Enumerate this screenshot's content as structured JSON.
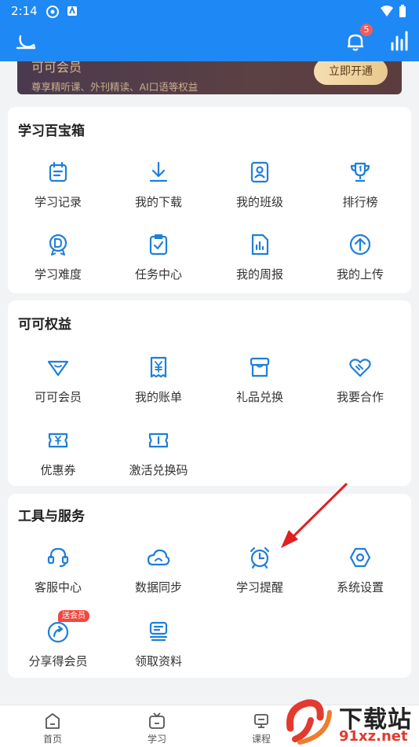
{
  "status": {
    "time": "2:14"
  },
  "header": {
    "badge_count": "5"
  },
  "banner": {
    "title": "可可会员",
    "subtitle": "尊享精听课、外刊精读、AI口语等权益",
    "button": "立即开通"
  },
  "toolbox": {
    "title": "学习百宝箱",
    "items": [
      {
        "label": "学习记录",
        "icon": "calendar-icon"
      },
      {
        "label": "我的下载",
        "icon": "download-icon"
      },
      {
        "label": "我的班级",
        "icon": "class-icon"
      },
      {
        "label": "排行榜",
        "icon": "trophy-icon"
      },
      {
        "label": "学习难度",
        "icon": "difficulty-badge-icon"
      },
      {
        "label": "任务中心",
        "icon": "clipboard-check-icon"
      },
      {
        "label": "我的周报",
        "icon": "report-chart-icon"
      },
      {
        "label": "我的上传",
        "icon": "upload-icon"
      }
    ]
  },
  "benefits": {
    "title": "可可权益",
    "items": [
      {
        "label": "可可会员",
        "icon": "diamond-icon"
      },
      {
        "label": "我的账单",
        "icon": "bill-yen-icon"
      },
      {
        "label": "礼品兑换",
        "icon": "gift-box-icon"
      },
      {
        "label": "我要合作",
        "icon": "handshake-heart-icon"
      },
      {
        "label": "优惠券",
        "icon": "coupon-yen-icon"
      },
      {
        "label": "激活兑换码",
        "icon": "ticket-icon"
      }
    ]
  },
  "tools": {
    "title": "工具与服务",
    "items": [
      {
        "label": "客服中心",
        "icon": "headset-icon"
      },
      {
        "label": "数据同步",
        "icon": "cloud-icon"
      },
      {
        "label": "学习提醒",
        "icon": "alarm-clock-icon"
      },
      {
        "label": "系统设置",
        "icon": "hexagon-settings-icon"
      },
      {
        "label": "分享得会员",
        "icon": "share-icon",
        "tag": "送会员"
      },
      {
        "label": "领取资料",
        "icon": "document-stack-icon"
      }
    ]
  },
  "tabbar": {
    "tabs": [
      {
        "label": "首页",
        "icon": "home-icon"
      },
      {
        "label": "学习",
        "icon": "tv-icon"
      },
      {
        "label": "课程",
        "icon": "course-icon"
      }
    ]
  },
  "watermark": {
    "text1": "下载站",
    "text2": "91xz.net"
  },
  "colors": {
    "primary": "#1e88f5",
    "icon_blue": "#1e7fd8",
    "arrow": "#e02020"
  }
}
